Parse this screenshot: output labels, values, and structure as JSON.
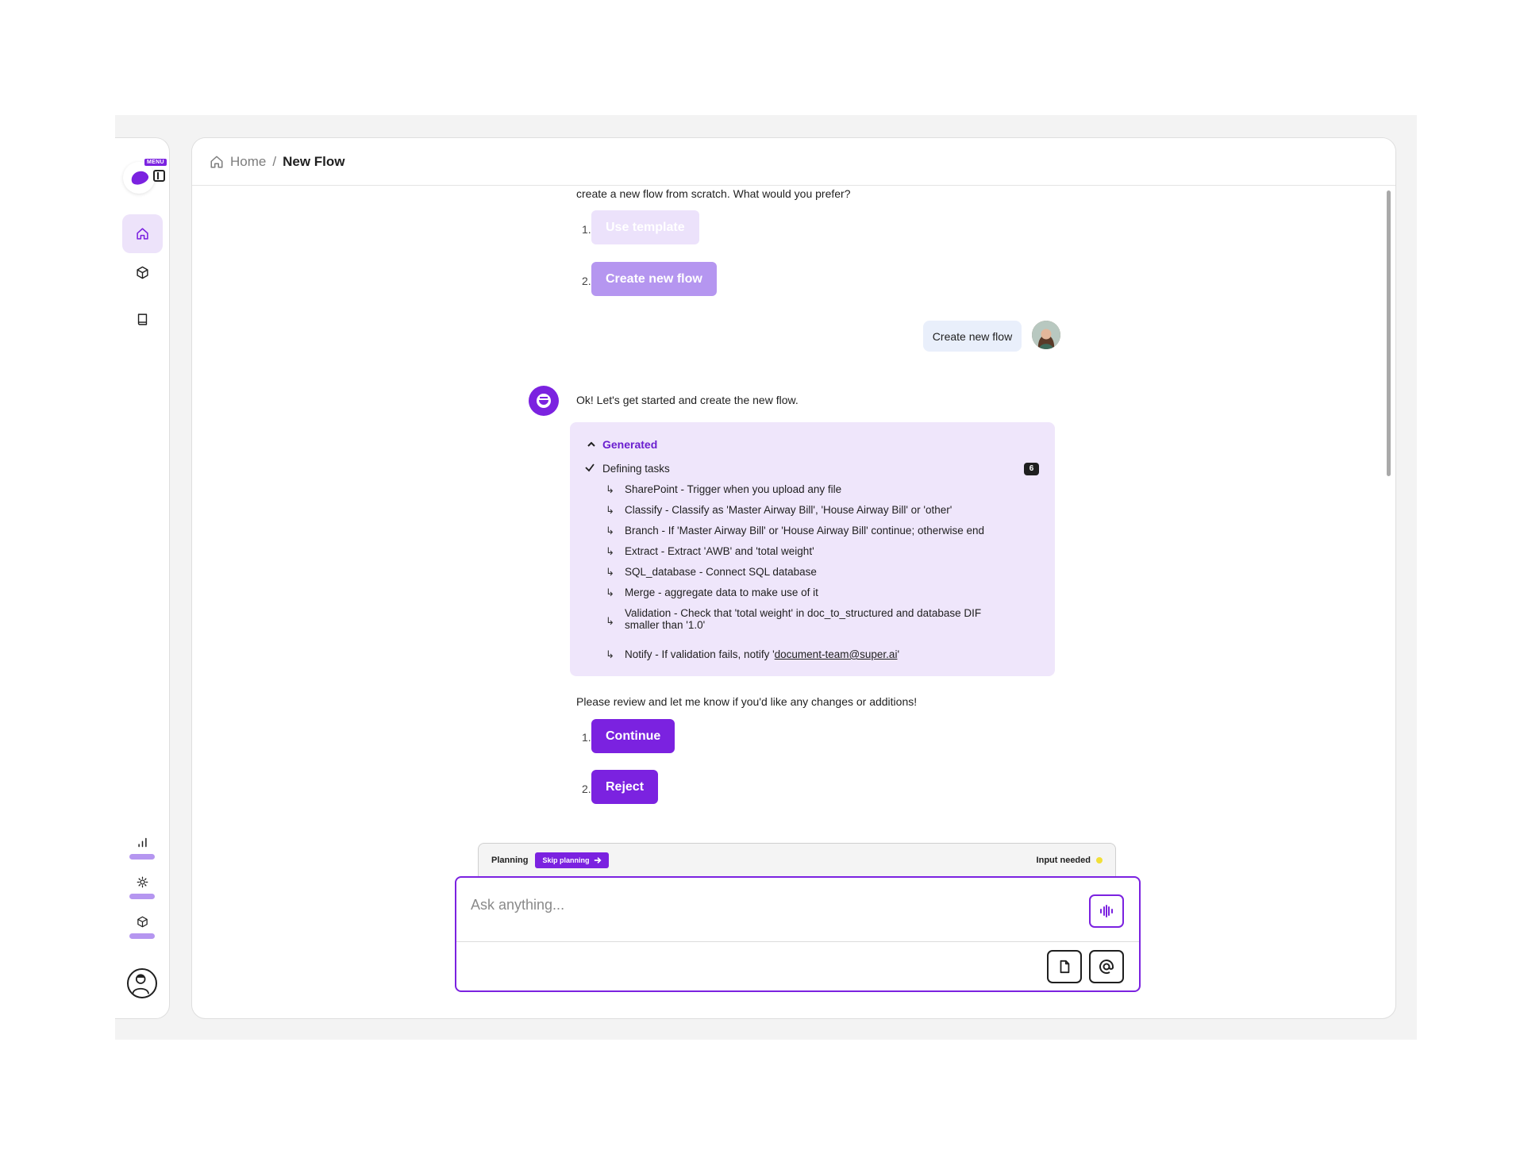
{
  "sidebar": {
    "menu_badge": "MENU",
    "nav": [
      {
        "icon": "home-icon",
        "active": true
      },
      {
        "icon": "cube-icon",
        "active": false
      },
      {
        "icon": "book-icon",
        "active": false
      }
    ],
    "bottom": [
      {
        "icon": "bar-chart-icon"
      },
      {
        "icon": "sun-icon"
      },
      {
        "icon": "cube-icon"
      }
    ]
  },
  "breadcrumb": {
    "home": "Home",
    "separator": "/",
    "current": "New Flow"
  },
  "chat": {
    "intro_text": "create a new flow from scratch. What would you prefer?",
    "first_options": [
      {
        "number": "1.",
        "label": "Use template"
      },
      {
        "number": "2.",
        "label": "Create new flow"
      }
    ],
    "user_message": "Create new flow",
    "bot_message": "Ok! Let's get started and create the new flow.",
    "generated": {
      "title": "Generated",
      "section": "Defining tasks",
      "count": "6",
      "tasks": [
        "SharePoint - Trigger when you upload any file",
        "Classify - Classify as 'Master Airway Bill', 'House Airway Bill' or 'other'",
        "Branch - If 'Master Airway Bill' or 'House Airway Bill' continue; otherwise end",
        "Extract - Extract 'AWB' and 'total weight'",
        "SQL_database - Connect SQL database",
        "Merge - aggregate data to make use of it",
        "Validation - Check that 'total weight' in doc_to_structured and database DIF",
        "smaller than '1.0'",
        "Notify - If validation fails, notify '",
        "document-team@super.ai",
        "'"
      ]
    },
    "review_text": "Please review and let me know if you'd like any changes or additions!",
    "second_options": [
      {
        "number": "1.",
        "label": "Continue"
      },
      {
        "number": "2.",
        "label": "Reject"
      }
    ]
  },
  "composer": {
    "planning_label": "Planning",
    "skip_label": "Skip planning",
    "status_label": "Input needed",
    "placeholder": "Ask anything...",
    "status_color": "#f1df38"
  },
  "colors": {
    "accent": "#7b22e0",
    "accent_light": "#b596f0",
    "generated_bg": "#efe6fb"
  }
}
